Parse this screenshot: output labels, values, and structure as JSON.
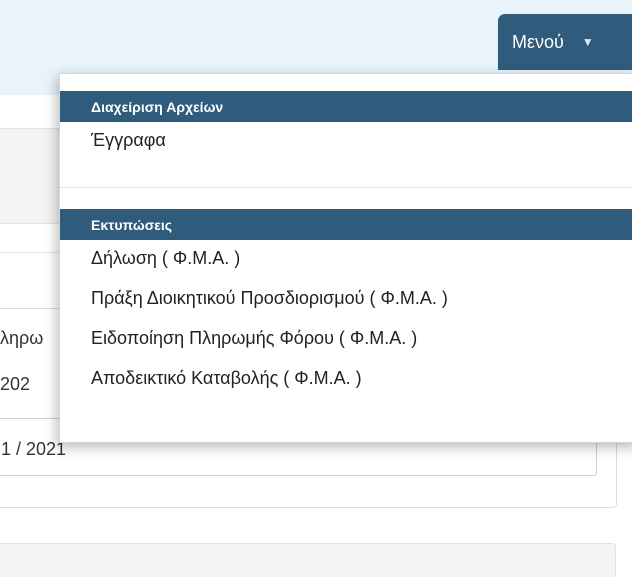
{
  "header": {
    "menu_label": "Μενού",
    "menu_icon": "caret-down-icon"
  },
  "background": {
    "fragment_1": "ληρω",
    "fragment_2": "202",
    "field_value": "1 / 2021"
  },
  "dropdown": {
    "sections": [
      {
        "title": "Διαχείριση Αρχείων",
        "items": [
          "Έγγραφα"
        ]
      },
      {
        "title": "Εκτυπώσεις",
        "items": [
          "Δήλωση ( Φ.Μ.Α. )",
          "Πράξη Διοικητικού Προσδιορισμού ( Φ.Μ.Α. )",
          "Ειδοποίηση Πληρωμής Φόρου ( Φ.Μ.Α. )",
          "Αποδεικτικό Καταβολής ( Φ.Μ.Α. )"
        ]
      }
    ]
  },
  "colors": {
    "accent": "#2f5b7c",
    "topbar": "#e8f3fa"
  }
}
